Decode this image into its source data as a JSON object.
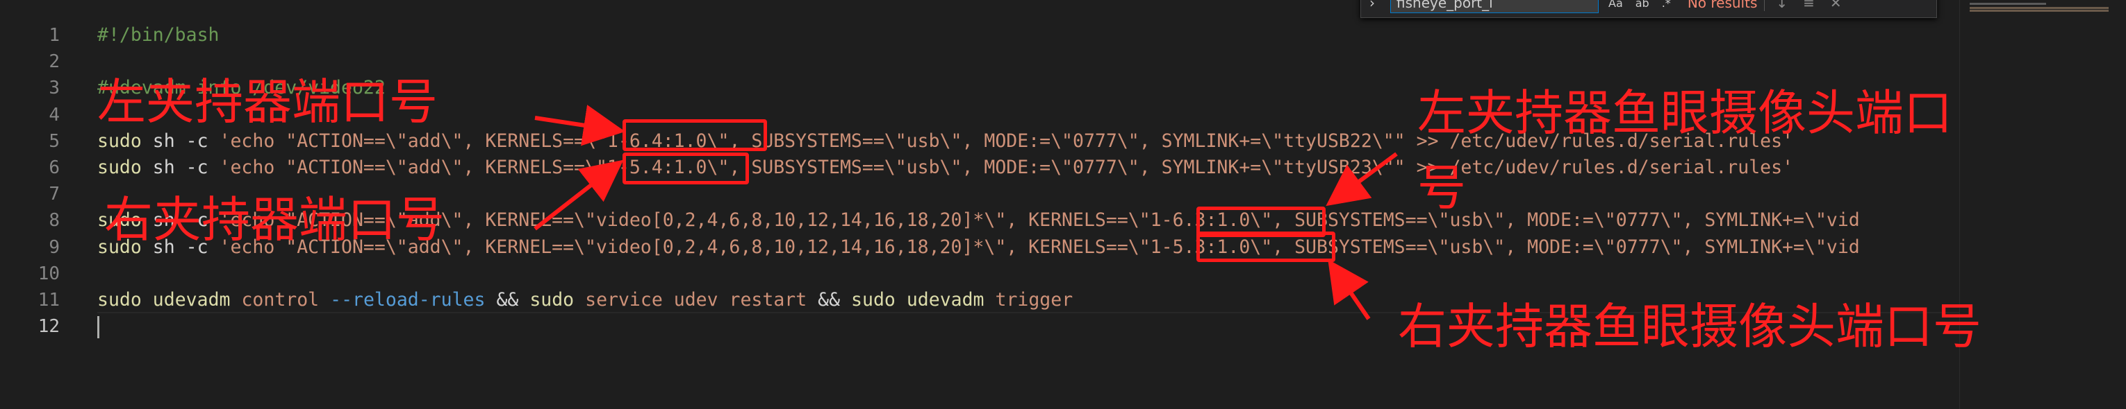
{
  "editor": {
    "line_numbers": [
      "1",
      "2",
      "3",
      "4",
      "5",
      "6",
      "7",
      "8",
      "9",
      "10",
      "11",
      "12"
    ],
    "lines": [
      [
        {
          "c": "cm",
          "t": "#!/bin/bash"
        }
      ],
      [],
      [
        {
          "c": "cm",
          "t": "#udevadm info /dev/video22"
        }
      ],
      [],
      [
        {
          "c": "kw",
          "t": "sudo"
        },
        {
          "c": "tx",
          "t": " sh -c "
        },
        {
          "c": "st",
          "t": "'echo \"ACTION==\\\"add\\\", KERNELS==\\\"1-6.4:1.0\\\", SUBSYSTEMS==\\\"usb\\\", MODE:=\\\"0777\\\", SYMLINK+=\\\"ttyUSB22\\\"\" >> /etc/udev/rules.d/serial.rules'"
        }
      ],
      [
        {
          "c": "kw",
          "t": "sudo"
        },
        {
          "c": "tx",
          "t": " sh -c "
        },
        {
          "c": "st",
          "t": "'echo \"ACTION==\\\"add\\\", KERNELS==\\\"1-5.4:1.0\\\", SUBSYSTEMS==\\\"usb\\\", MODE:=\\\"0777\\\", SYMLINK+=\\\"ttyUSB23\\\"\" >> /etc/udev/rules.d/serial.rules'"
        }
      ],
      [],
      [
        {
          "c": "kw",
          "t": "sudo"
        },
        {
          "c": "tx",
          "t": " sh -c "
        },
        {
          "c": "st",
          "t": "'echo \"ACTION==\\\"add\\\", KERNEL==\\\"video[0,2,4,6,8,10,12,14,16,18,20]*\\\", KERNELS==\\\"1-6.3:1.0\\\", SUBSYSTEMS==\\\"usb\\\", MODE:=\\\"0777\\\", SYMLINK+=\\\"vid"
        }
      ],
      [
        {
          "c": "kw",
          "t": "sudo"
        },
        {
          "c": "tx",
          "t": " sh -c "
        },
        {
          "c": "st",
          "t": "'echo \"ACTION==\\\"add\\\", KERNEL==\\\"video[0,2,4,6,8,10,12,14,16,18,20]*\\\", KERNELS==\\\"1-5.3:1.0\\\", SUBSYSTEMS==\\\"usb\\\", MODE:=\\\"0777\\\", SYMLINK+=\\\"vid"
        }
      ],
      [],
      [
        {
          "c": "kw",
          "t": "sudo"
        },
        {
          "c": "tx",
          "t": " "
        },
        {
          "c": "kw",
          "t": "udevadm"
        },
        {
          "c": "tx",
          "t": " "
        },
        {
          "c": "st",
          "t": "control"
        },
        {
          "c": "tx",
          "t": " "
        },
        {
          "c": "fl",
          "t": "--reload-rules"
        },
        {
          "c": "tx",
          "t": " && "
        },
        {
          "c": "kw",
          "t": "sudo"
        },
        {
          "c": "tx",
          "t": " "
        },
        {
          "c": "st",
          "t": "service udev restart"
        },
        {
          "c": "tx",
          "t": " && "
        },
        {
          "c": "kw",
          "t": "sudo"
        },
        {
          "c": "tx",
          "t": " "
        },
        {
          "c": "kw",
          "t": "udevadm"
        },
        {
          "c": "tx",
          "t": " "
        },
        {
          "c": "st",
          "t": "trigger"
        }
      ],
      []
    ]
  },
  "find_widget": {
    "toggle_icon": "chevron-right-icon",
    "query": "fisheye_port_l",
    "options": [
      "Aa",
      "ab",
      ".*"
    ],
    "status": "No results",
    "buttons": [
      "arrow-down-icon",
      "menu-icon",
      "close-icon"
    ]
  },
  "annotations": {
    "left_gripper_port": "左夹持器端口号",
    "right_gripper_port": "右夹持器端口号",
    "left_fisheye_port_line1": "左夹持器鱼眼摄像头端口",
    "left_fisheye_port_line2": "号",
    "right_fisheye_port": "右夹持器鱼眼摄像头端口号",
    "color": "#ff1a1a"
  }
}
